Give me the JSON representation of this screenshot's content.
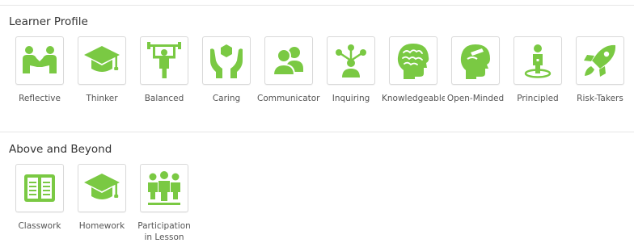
{
  "colors": {
    "accent": "#7ac943",
    "text": "#333333",
    "label": "#555555",
    "border": "#d9d9d9"
  },
  "learner_profile": {
    "title": "Learner Profile",
    "items": [
      {
        "label": "Reflective",
        "icon": "handshake-icon"
      },
      {
        "label": "Thinker",
        "icon": "graduation-cap-icon"
      },
      {
        "label": "Balanced",
        "icon": "weightlifter-icon"
      },
      {
        "label": "Caring",
        "icon": "caring-hands-icon"
      },
      {
        "label": "Communicators",
        "icon": "people-icon"
      },
      {
        "label": "Inquiring",
        "icon": "network-person-icon"
      },
      {
        "label": "Knowledgeable",
        "icon": "brain-icon"
      },
      {
        "label": "Open-Minded",
        "icon": "head-profile-icon"
      },
      {
        "label": "Principled",
        "icon": "person-podium-icon"
      },
      {
        "label": "Risk-Takers",
        "icon": "rocket-icon"
      }
    ]
  },
  "above_and_beyond": {
    "title": "Above and Beyond",
    "items": [
      {
        "label": "Classwork",
        "icon": "open-book-icon"
      },
      {
        "label": "Homework",
        "icon": "graduation-cap-icon"
      },
      {
        "label": "Participation in Lesson",
        "icon": "group-icon"
      }
    ]
  }
}
